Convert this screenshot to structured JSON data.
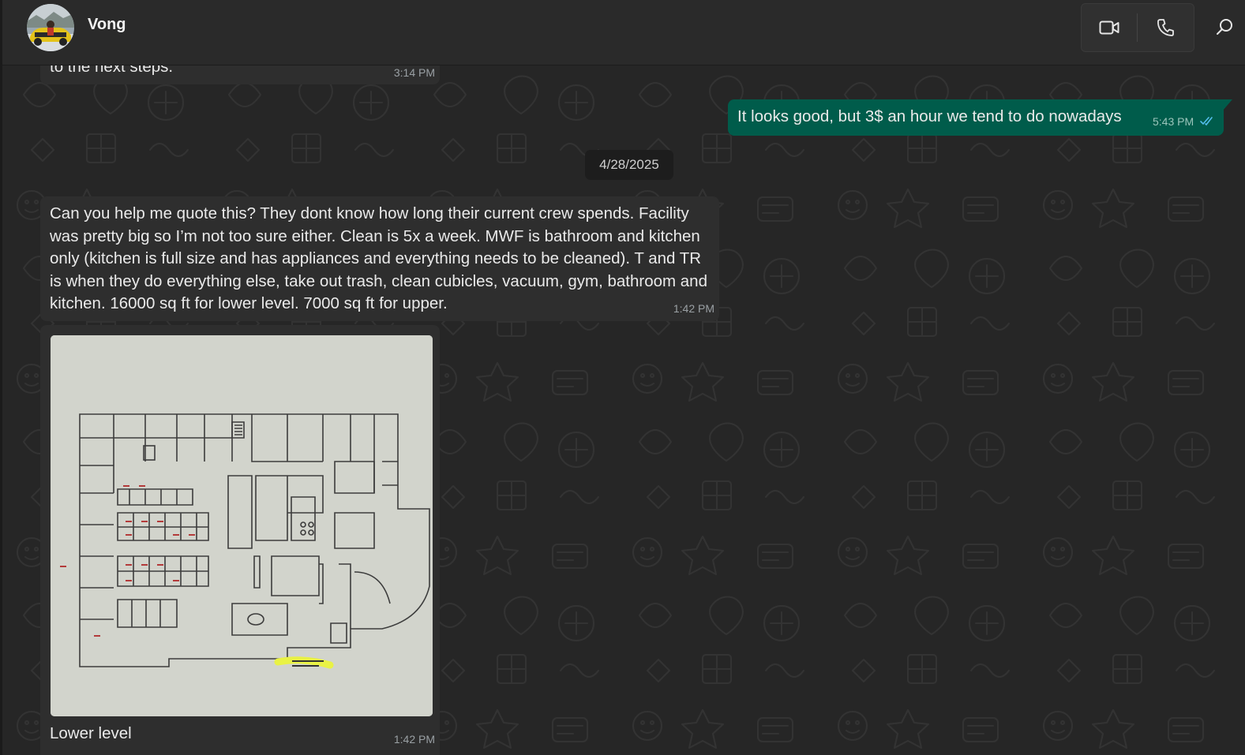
{
  "header": {
    "contact_name": "Vong",
    "video_call_icon": "video-camera-icon",
    "voice_call_icon": "phone-icon",
    "search_icon": "search-icon"
  },
  "messages": [
    {
      "direction": "incoming",
      "text": "to the next steps.",
      "time": "3:14 PM"
    },
    {
      "direction": "outgoing",
      "text": "It looks good, but 3$ an hour we tend to do nowadays",
      "time": "5:43 PM",
      "status_icon": "double-check-read-icon"
    },
    {
      "type": "date_separator",
      "text": "4/28/2025"
    },
    {
      "direction": "incoming",
      "text": "Can you help me quote this? They dont know how long their current crew spends. Facility was pretty big so I’m not too sure either. Clean is 5x a week. MWF is bathroom and kitchen only (kitchen is full size and has appliances and everything needs to be cleaned). T and TR is when they do everything else, take out trash, clean cubicles, vacuum, gym, bathroom and kitchen. 16000 sq ft for lower level. 7000 sq ft for upper.",
      "time": "1:42 PM"
    },
    {
      "direction": "incoming",
      "type": "image",
      "image_description_icon": "floor-plan-photo",
      "caption": "Lower level",
      "time": "1:42 PM"
    }
  ],
  "colors": {
    "background": "#262626",
    "incoming_bubble": "#2e2e2e",
    "outgoing_bubble": "#005c4b",
    "read_tick": "#53bdeb"
  }
}
